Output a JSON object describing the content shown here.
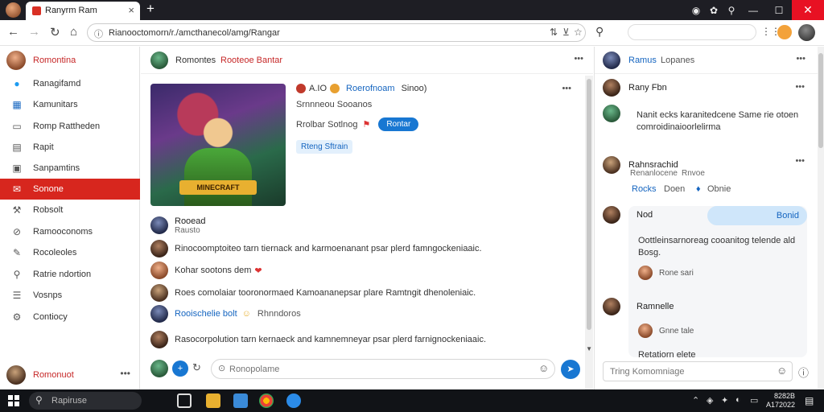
{
  "browser": {
    "tab_title": "Ranyrm Ram",
    "tab_close": "×",
    "new_tab": "+",
    "url": "Rianooctomorn/r./amcthanecol/amg/Rangar"
  },
  "window_controls": {
    "minimize": "—",
    "maximize": "☐",
    "close": "✕"
  },
  "sidebar": {
    "profile_name": "Romontina",
    "items": [
      {
        "label": "Ranagifamd",
        "icon": "twitter-icon"
      },
      {
        "label": "Kamunitars",
        "icon": "chart-icon"
      },
      {
        "label": "Romp Rattheden",
        "icon": "document-icon"
      },
      {
        "label": "Rapit",
        "icon": "calendar-icon"
      },
      {
        "label": "Sanpamtins",
        "icon": "contacts-icon"
      },
      {
        "label": "Sonone",
        "icon": "mail-icon"
      },
      {
        "label": "Robsolt",
        "icon": "tools-icon"
      },
      {
        "label": "Ramooconoms",
        "icon": "link-icon"
      },
      {
        "label": "Rocoleoles",
        "icon": "pencil-icon"
      },
      {
        "label": "Ratrie ndortion",
        "icon": "wrench-icon"
      },
      {
        "label": "Vosnps",
        "icon": "list-icon"
      },
      {
        "label": "Contiocy",
        "icon": "settings-icon"
      }
    ],
    "bottom_profile_name": "Romonuot",
    "bottom_dots": "•••"
  },
  "center": {
    "header_name": "Romontes",
    "header_sub": "Rooteoe Bantar",
    "header_dots": "•••",
    "post": {
      "image_badge": "MINECRAFT",
      "line1_a": "A.IO",
      "line1_b": "Roerofnoam",
      "line1_c": "Sinoo)",
      "line2": "Srnnneou   Sooanos",
      "line3": "Rrolbar   Sotlnog",
      "pill": "Rontar",
      "tag": "Rteng Sftrain",
      "dots": "•••"
    },
    "comments": [
      {
        "name": "Rooead",
        "sub": "Rausto"
      },
      {
        "text": "Rinocoomptoiteo tarn tiernack and karmoenanant psar plerd famngockeniaaic."
      },
      {
        "text": "Kohar sootons dem"
      },
      {
        "text": "Roes comolaiar  tooronormaed  Kamoananepsar plare  Ramtngit  dhenoleniaic."
      },
      {
        "name": "Rooischelie bolt",
        "sub": "Rhnndoros"
      },
      {
        "text": "Rasocorpolution tarn kernaeck and kamnemneyar psar plerd farnignockeniaaic."
      }
    ],
    "composer_placeholder": "Ronopolame"
  },
  "right": {
    "header_a": "Ramus",
    "header_b": "Lopanes",
    "dots": "•••",
    "msg1_name": "Rany Fbn",
    "msg1_text": "Nanit ecks karanitedcene Same rie otoen comroidinaioorlelirma",
    "msg2_name": "Rahnsrachid",
    "msg2_sub1": "Renanlocene",
    "msg2_sub2": "Rnvoe",
    "actions": [
      "Rocks",
      "Doen",
      "Obnie"
    ],
    "thread_user": "Nod",
    "bubble_label": "Bonid",
    "thread_text": "Oottleinsarnoreag cooanitog telende ald Bosg.",
    "thread_sub1": "Rone sari",
    "thread_user2": "Ramnelle",
    "thread_sub2": "Gnne tale",
    "thread_more": "Retatiorn elete",
    "compose_placeholder": "Tring Komomniage"
  },
  "taskbar": {
    "search_placeholder": "Rapiruse",
    "clock_time": "8282B",
    "clock_date": "A172022"
  },
  "colors": {
    "accent_red": "#d7261e",
    "link_blue": "#1565c0",
    "button_blue": "#1877d2"
  }
}
